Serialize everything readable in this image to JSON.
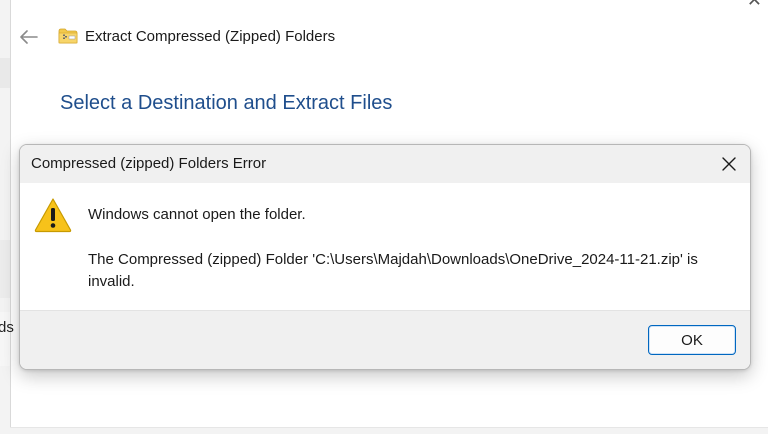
{
  "background_window": {
    "title": "Extract Compressed (Zipped) Folders",
    "heading": "Select a Destination and Extract Files",
    "stray_text": "ds",
    "back_icon": "back-arrow-icon",
    "folder_icon": "zipped-folder-icon"
  },
  "dialog": {
    "title": "Compressed (zipped) Folders Error",
    "message": "Windows cannot open the folder.",
    "detail": "The Compressed (zipped) Folder 'C:\\Users\\Majdah\\Downloads\\OneDrive_2024-11-21.zip' is invalid.",
    "ok_label": "OK",
    "icon": "warning-icon"
  },
  "colors": {
    "heading": "#1f4e8c",
    "warning": "#f7c21a",
    "accent": "#0067c0"
  }
}
